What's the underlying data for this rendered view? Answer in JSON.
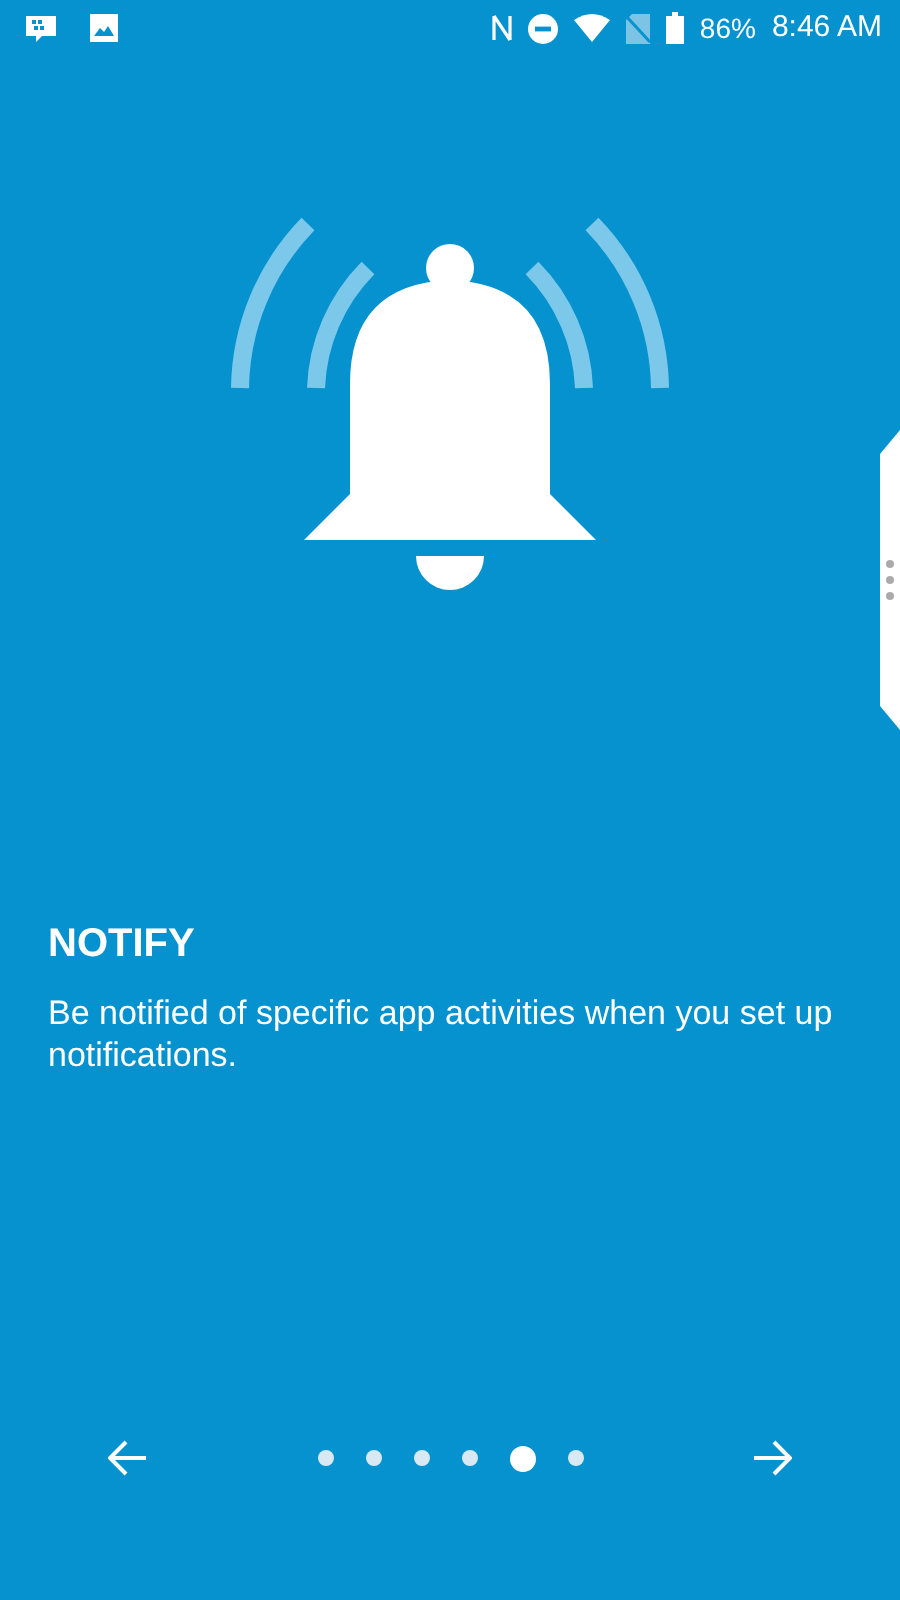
{
  "status_bar": {
    "battery": "86%",
    "time": "8:46 AM"
  },
  "slide": {
    "title": "NOTIFY",
    "description": "Be notified of specific app activities when you set up notifications."
  },
  "pager": [
    {
      "selected": false
    },
    {
      "selected": false
    },
    {
      "selected": false
    },
    {
      "selected": false
    },
    {
      "selected": true
    },
    {
      "selected": false
    }
  ]
}
